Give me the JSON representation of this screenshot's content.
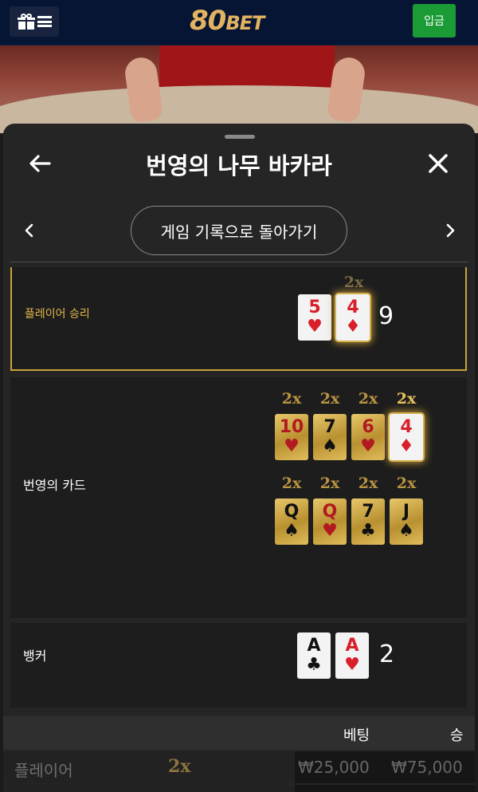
{
  "header": {
    "logo_main": "80",
    "logo_sub": "BET",
    "deposit_label": "입금",
    "icons": [
      "gift-icon",
      "menu-icon"
    ]
  },
  "sheet": {
    "title": "번영의 나무 바카라",
    "return_label": "게임 기록으로 돌아가기",
    "icons": [
      "back-arrow-icon",
      "close-icon",
      "chevron-left-icon",
      "chevron-right-icon"
    ]
  },
  "player": {
    "label": "플레이어 승리",
    "score": "9",
    "multiplier": "2x",
    "cards": [
      {
        "rank": "5",
        "suit": "♥"
      },
      {
        "rank": "4",
        "suit": "♦"
      }
    ]
  },
  "prosperity": {
    "label": "번영의 카드",
    "row1": [
      {
        "rank": "10",
        "suit": "♥",
        "mult": "2x"
      },
      {
        "rank": "7",
        "suit": "♠",
        "mult": "2x"
      },
      {
        "rank": "6",
        "suit": "♥",
        "mult": "2x"
      },
      {
        "rank": "4",
        "suit": "♦",
        "mult": "2x"
      }
    ],
    "row2": [
      {
        "rank": "Q",
        "suit": "♠",
        "mult": "2x"
      },
      {
        "rank": "Q",
        "suit": "♥",
        "mult": "2x"
      },
      {
        "rank": "7",
        "suit": "♣",
        "mult": "2x"
      },
      {
        "rank": "J",
        "suit": "♠",
        "mult": "2x"
      }
    ]
  },
  "banker": {
    "label": "뱅커",
    "score": "2",
    "cards": [
      {
        "rank": "A",
        "suit": "♣"
      },
      {
        "rank": "A",
        "suit": "♥"
      }
    ]
  },
  "bets_table": {
    "col_bet": "베팅",
    "col_win": "승",
    "rows": [
      {
        "name": "플레이어",
        "mult": "2x",
        "bet": "₩25,000",
        "win": "₩75,000"
      }
    ]
  },
  "colors": {
    "accent_gold": "#c9a43a",
    "deposit_green": "#1a9b35",
    "topbar_navy": "#061533"
  }
}
